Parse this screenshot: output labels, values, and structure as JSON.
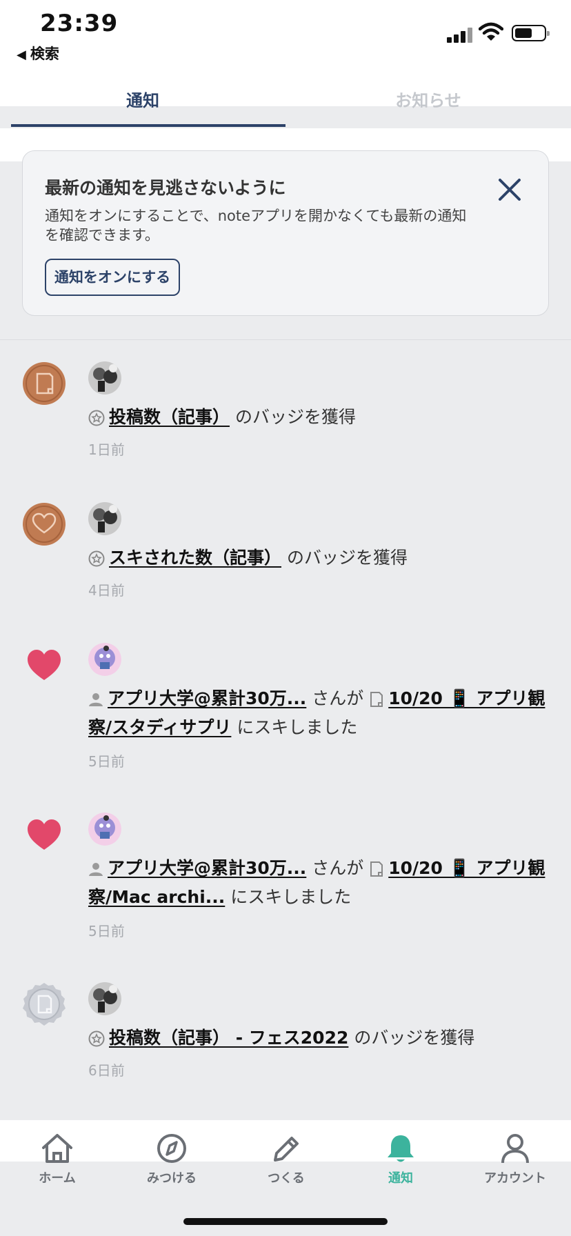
{
  "status_bar": {
    "time": "23:39",
    "back_label": "検索"
  },
  "tabs": [
    {
      "label": "通知",
      "active": true
    },
    {
      "label": "お知らせ",
      "active": false
    }
  ],
  "banner": {
    "title": "最新の通知を見逃さないように",
    "description": "通知をオンにすることで、noteアプリを開かなくても最新の通知を確認できます。",
    "button_label": "通知をオンにする"
  },
  "notifications": [
    {
      "lead_icon": "post-badge-bronze-icon",
      "parts": [
        {
          "t": "link",
          "v": "投稿数（記事）"
        },
        {
          "t": "text",
          "v": " のバッジを獲得"
        }
      ],
      "time": "1日前"
    },
    {
      "lead_icon": "like-badge-bronze-icon",
      "parts": [
        {
          "t": "link",
          "v": "スキされた数（記事）"
        },
        {
          "t": "text",
          "v": " のバッジを獲得"
        }
      ],
      "time": "4日前"
    },
    {
      "lead_icon": "heart-icon",
      "parts": [
        {
          "t": "link",
          "v": "アプリ大学@累計30万..."
        },
        {
          "t": "text",
          "v": " さんが "
        },
        {
          "t": "link",
          "v": "10/20 📱 アプリ観察/スタディサプリ"
        },
        {
          "t": "text",
          "v": " にスキしました"
        }
      ],
      "time": "5日前"
    },
    {
      "lead_icon": "heart-icon",
      "parts": [
        {
          "t": "link",
          "v": "アプリ大学@累計30万..."
        },
        {
          "t": "text",
          "v": " さんが "
        },
        {
          "t": "link",
          "v": "10/20 📱 アプリ観察/Mac archi..."
        },
        {
          "t": "text",
          "v": " にスキしました"
        }
      ],
      "time": "5日前"
    },
    {
      "lead_icon": "post-badge-silver-icon",
      "parts": [
        {
          "t": "link",
          "v": "投稿数（記事） - フェス2022"
        },
        {
          "t": "text",
          "v": " のバッジを獲得"
        }
      ],
      "time": "6日前"
    }
  ],
  "bottom_nav": [
    {
      "label": "ホーム",
      "icon": "home-icon",
      "active": false
    },
    {
      "label": "みつける",
      "icon": "compass-icon",
      "active": false
    },
    {
      "label": "つくる",
      "icon": "pencil-icon",
      "active": false
    },
    {
      "label": "通知",
      "icon": "bell-icon",
      "active": true
    },
    {
      "label": "アカウント",
      "icon": "person-icon",
      "active": false
    }
  ],
  "colors": {
    "navy": "#2c4268",
    "accent_green": "#3cb39d",
    "heart_red": "#e2486a",
    "bronze": "#c07b52",
    "silver": "#c6c9d0"
  }
}
